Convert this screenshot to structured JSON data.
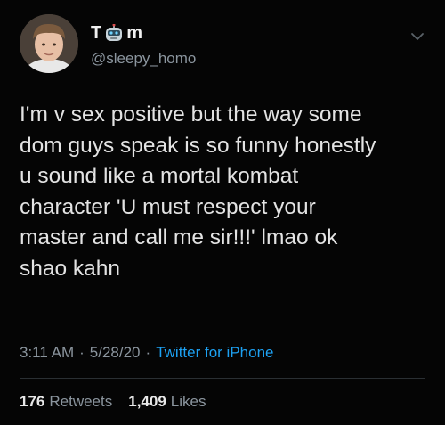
{
  "tweet": {
    "display_name_prefix": "T",
    "display_name_suffix": "m",
    "name_emoji": "robot-face-emoji",
    "handle": "@sleepy_homo",
    "avatar": "profile-photo",
    "text": "I'm v sex positive but the way some\ndom guys speak is so funny honestly\nu sound like a mortal kombat\ncharacter 'U must respect your\nmaster and call me sir!!!' lmao ok\nshao kahn",
    "time": "3:11 AM",
    "separator": "·",
    "date": "5/28/20",
    "source": "Twitter for iPhone",
    "retweets_count": "176",
    "retweets_label": "Retweets",
    "likes_count": "1,409",
    "likes_label": "Likes"
  },
  "colors": {
    "background": "#050505",
    "text": "#e3e3e3",
    "muted": "#8b959e",
    "link": "#1da1f2"
  }
}
